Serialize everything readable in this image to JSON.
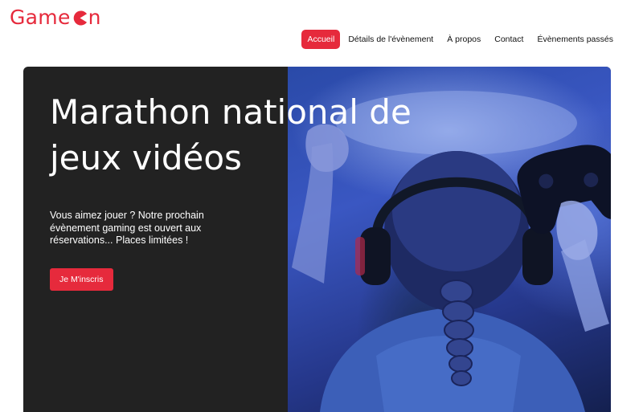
{
  "brand": {
    "logo_text_start": "Game",
    "logo_text_end": "n",
    "accent": "#e62a3c"
  },
  "nav": {
    "items": [
      {
        "label": "Accueil",
        "active": true
      },
      {
        "label": "Détails de l'évènement",
        "active": false
      },
      {
        "label": "À propos",
        "active": false
      },
      {
        "label": "Contact",
        "active": false
      },
      {
        "label": "Évènements passés",
        "active": false
      }
    ]
  },
  "hero": {
    "title": "Marathon national de jeux vidéos",
    "text": "Vous aimez jouer ? Notre prochain évènement gaming est ouvert aux réservations... Places limitées !",
    "cta_label": "Je M'inscris",
    "image_icon": "gamer-with-headphones-and-controller"
  },
  "colors": {
    "hero_bg": "#222222",
    "accent": "#e62a3c"
  }
}
